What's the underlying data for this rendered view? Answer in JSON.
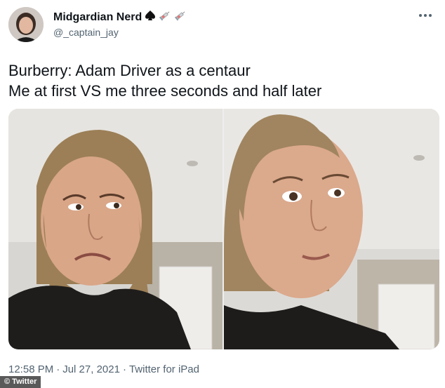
{
  "user": {
    "display_name": "Midgardian Nerd",
    "handle": "@_captain_jay",
    "name_emojis": [
      "spade-icon",
      "syringe-icon",
      "syringe-icon"
    ]
  },
  "tweet": {
    "lines": [
      "Burberry: Adam Driver as a centaur",
      "Me at first VS me three seconds and half later"
    ]
  },
  "media": {
    "photos": [
      {
        "expression": "disgusted-face"
      },
      {
        "expression": "intrigued-face"
      }
    ]
  },
  "meta": {
    "time": "12:58 PM",
    "separator": "·",
    "date": "Jul 27, 2021",
    "source": "Twitter for iPad"
  },
  "credit": {
    "label": "© Twitter"
  },
  "colors": {
    "text_primary": "#0f1419",
    "text_secondary": "#536471"
  }
}
